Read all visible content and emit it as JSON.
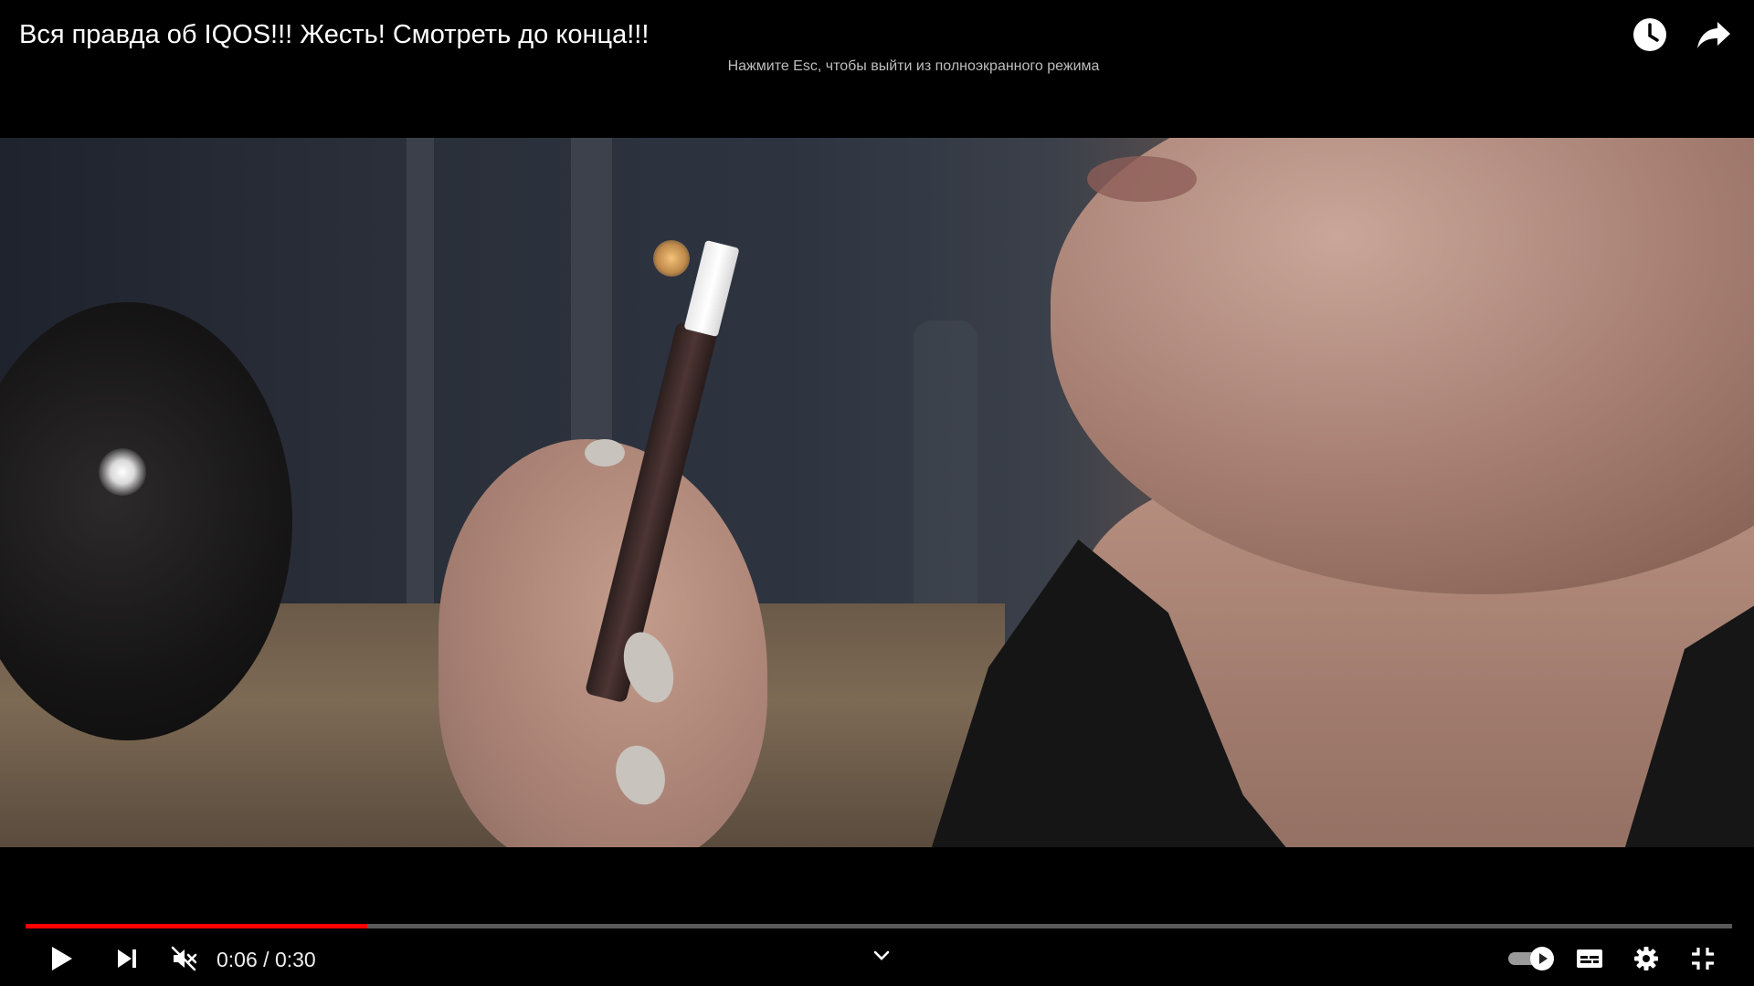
{
  "header": {
    "title": "Вся правда об IQOS!!! Жесть! Смотреть до конца!!!",
    "esc_hint": "Нажмите Esc, чтобы выйти из полноэкранного режима",
    "icons": [
      "watch-later-icon",
      "share-icon"
    ]
  },
  "player": {
    "current_time": "0:06",
    "separator": " / ",
    "duration": "0:30",
    "progress_fraction": 0.2,
    "accent_color": "#ff0000",
    "muted": true,
    "autoplay_on": true,
    "controls_left": [
      "play-icon",
      "next-icon",
      "volume-muted-icon"
    ],
    "controls_right": [
      "autoplay-toggle",
      "subtitles-icon",
      "settings-icon",
      "exit-fullscreen-icon"
    ]
  }
}
